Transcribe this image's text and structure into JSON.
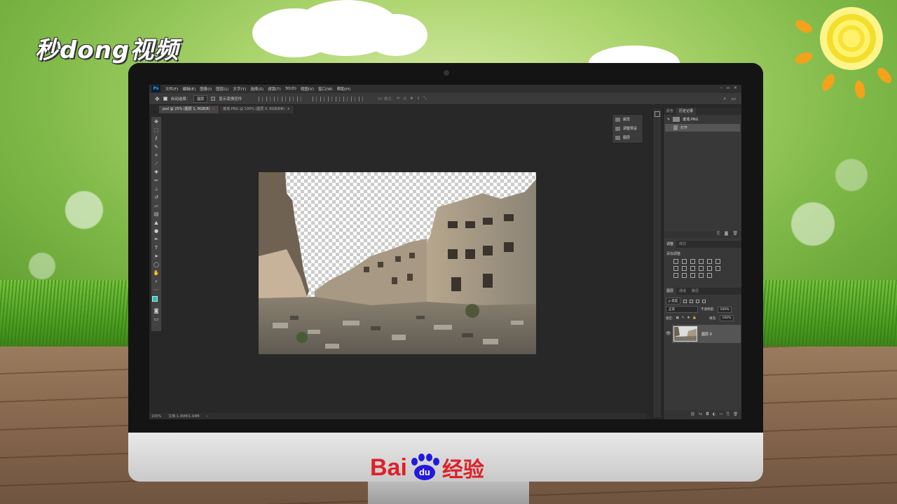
{
  "watermark": {
    "top_left_logo": "秒dong视频"
  },
  "brand": {
    "bai": "Bai",
    "du": "du",
    "jingyan": "经验"
  },
  "photoshop": {
    "app_logo": "Ps",
    "menu": [
      "文件(F)",
      "编辑(E)",
      "图像(I)",
      "图层(L)",
      "文字(Y)",
      "选择(S)",
      "滤镜(T)",
      "3D(D)",
      "视图(V)",
      "窗口(W)",
      "帮助(H)"
    ],
    "window_controls": [
      "–",
      "▫",
      "×"
    ],
    "options": {
      "auto_select_label": "自动选择：",
      "auto_select_value": "图层",
      "transform_label": "显示变换控件"
    },
    "tabs": [
      {
        "label": "psd @ 25% (图层 1, RGB/8)",
        "close": "×",
        "active": true
      },
      {
        "label": "废墟.PNG @ 100% (图层 0, RGB/8#)",
        "close": "×",
        "active": false
      }
    ],
    "float_panel": [
      "属性",
      "调整预设",
      "图层"
    ],
    "history_panel": {
      "tabs": [
        "颜色",
        "历史记录"
      ],
      "snapshot": "废墟.PNG",
      "steps": [
        "打开"
      ]
    },
    "adjustments_panel": {
      "tabs": [
        "调整",
        "样式"
      ],
      "title": "添加调整"
    },
    "layers_panel": {
      "tabs": [
        "图层",
        "通道",
        "路径"
      ],
      "filter_kind": "ρ 类型",
      "blend_mode": "正常",
      "opacity_label": "不透明度:",
      "opacity_value": "100%",
      "lock_label": "锁定:",
      "fill_label": "填充:",
      "fill_value": "100%",
      "layer_name": "图层 0"
    },
    "status": {
      "zoom": "100%",
      "doc_size": "文档:1.40M/1.94M"
    }
  },
  "icons": {
    "tools": [
      "move-icon",
      "marquee-icon",
      "lasso-icon",
      "quick-select-icon",
      "crop-icon",
      "eyedropper-icon",
      "healing-icon",
      "brush-icon",
      "stamp-icon",
      "history-brush-icon",
      "eraser-icon",
      "gradient-icon",
      "blur-icon",
      "dodge-icon",
      "pen-icon",
      "type-icon",
      "path-select-icon",
      "shape-icon",
      "hand-icon",
      "zoom-icon"
    ]
  },
  "colors": {
    "foreground": "#11c9c0",
    "background": "#7a1c8a",
    "ps_accent": "#31a8ff"
  }
}
